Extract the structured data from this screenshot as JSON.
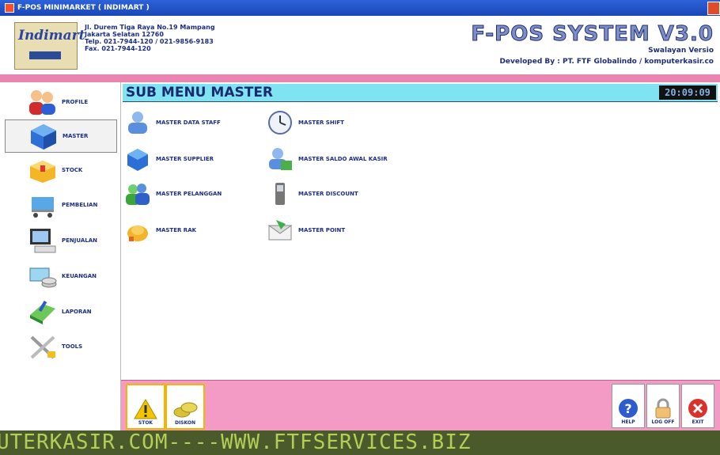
{
  "window": {
    "title": "F-POS MINIMARKET ( INDIMART )"
  },
  "header": {
    "logo_text": "Indimart",
    "address_lines": [
      "Jl. Durem Tiga Raya No.19 Mampang",
      "Jakarta Selatan 12760",
      "Telp. 021-7944-120 / 021-9856-9183",
      "Fax. 021-7944-120"
    ],
    "app_title": "F-POS SYSTEM V3.0",
    "version": "Swalayan Versio",
    "developer": "Developed By : PT. FTF Globalindo / komputerkasir.co"
  },
  "sidebar": {
    "items": [
      {
        "label": "PROFILE",
        "icon": "users-icon"
      },
      {
        "label": "MASTER",
        "icon": "cube-icon",
        "selected": true
      },
      {
        "label": "STOCK",
        "icon": "box-icon"
      },
      {
        "label": "PEMBELIAN",
        "icon": "shopping-cart-icon"
      },
      {
        "label": "PENJUALAN",
        "icon": "computer-icon"
      },
      {
        "label": "KEUANGAN",
        "icon": "money-icon"
      },
      {
        "label": "LAPORAN",
        "icon": "report-icon"
      },
      {
        "label": "TOOLS",
        "icon": "tools-icon"
      }
    ]
  },
  "main": {
    "title": "SUB MENU MASTER",
    "clock": "20:09:09",
    "items": [
      {
        "label": "MASTER DATA STAFF",
        "icon": "staff-icon"
      },
      {
        "label": "MASTER SHIFT",
        "icon": "clock-icon"
      },
      {
        "label": "MASTER SUPPLIER",
        "icon": "supplier-icon"
      },
      {
        "label": "MASTER SALDO AWAL KASIR",
        "icon": "cashier-balance-icon"
      },
      {
        "label": "MASTER PELANGGAN",
        "icon": "customers-icon"
      },
      {
        "label": "MASTER DISCOUNT",
        "icon": "phone-discount-icon"
      },
      {
        "label": "MASTER RAK",
        "icon": "shelf-icon"
      },
      {
        "label": "MASTER POINT",
        "icon": "envelope-point-icon"
      }
    ]
  },
  "bottom": {
    "stok_label": "STOK",
    "diskon_label": "DISKON",
    "help_label": "HELP",
    "logoff_label": "LOG OFF",
    "exit_label": "EXIT"
  },
  "marquee": {
    "text": "UTERKASIR.COM----WWW.FTFSERVICES.BIZ"
  },
  "colors": {
    "accent_pink": "#f39bc4",
    "title_cyan": "#7fe3f2",
    "navy_text": "#1b2d86",
    "marquee_text": "#b5ce58"
  }
}
